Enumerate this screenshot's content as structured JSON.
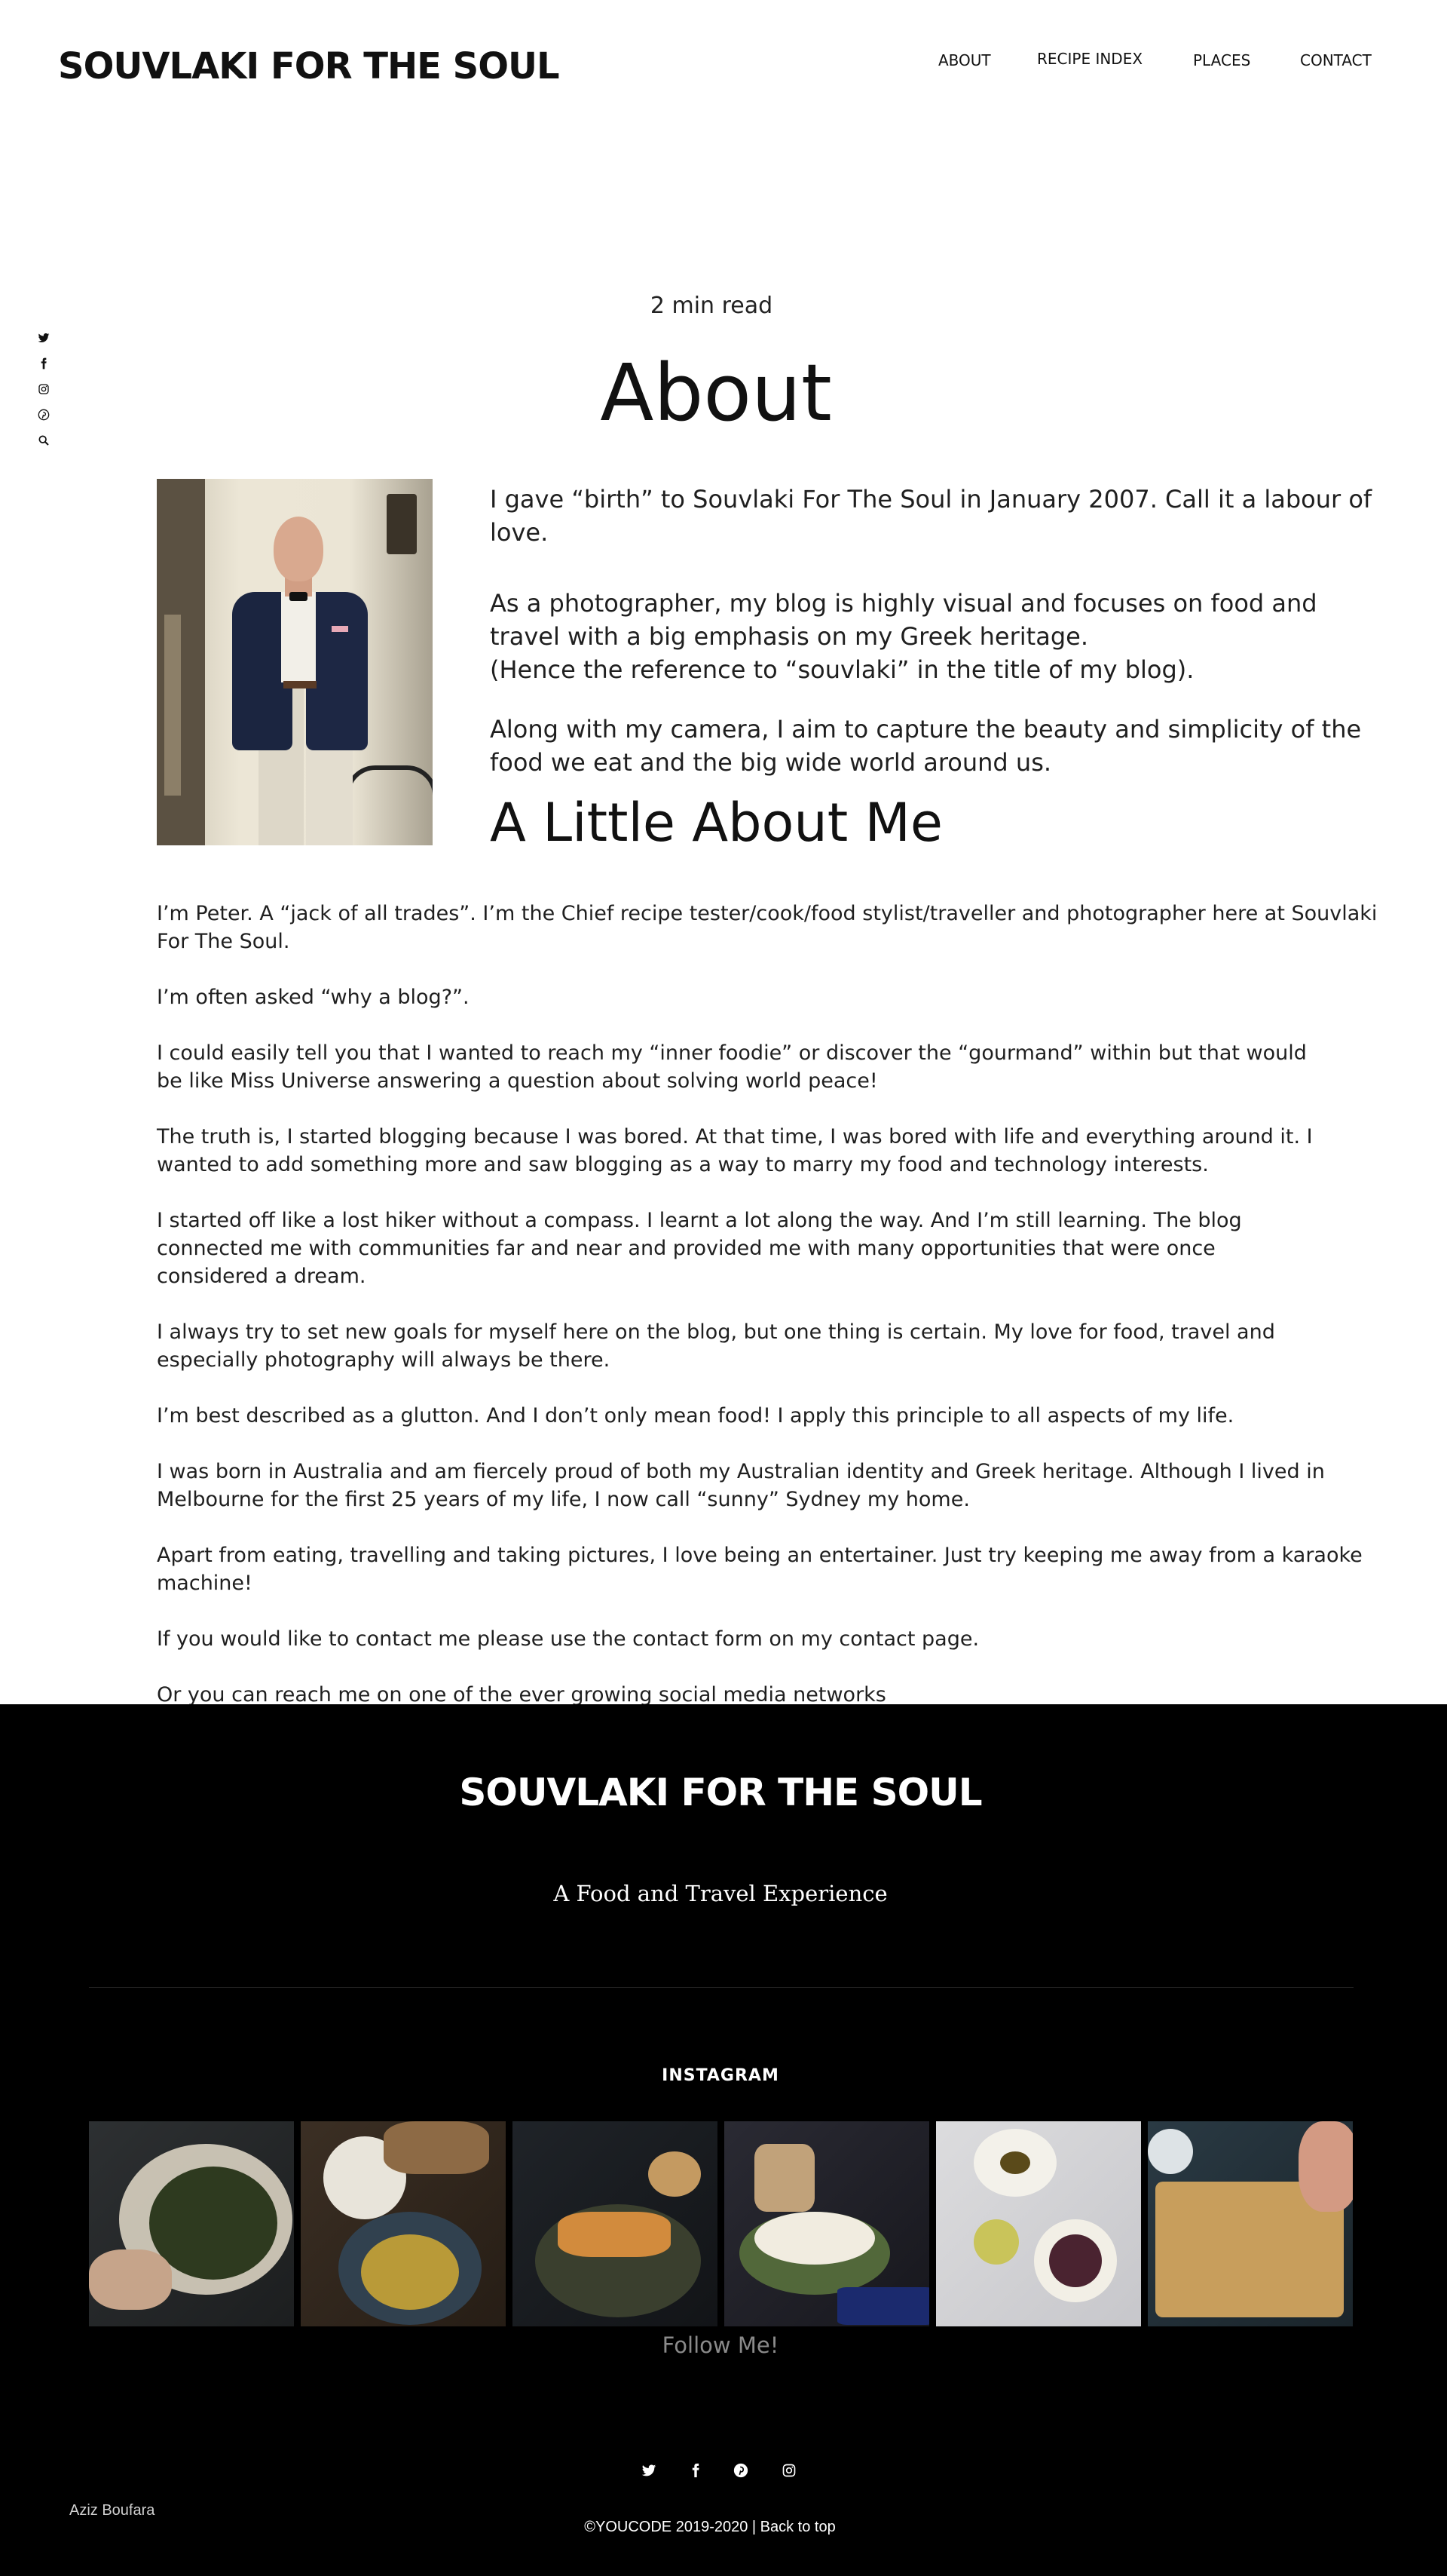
{
  "header": {
    "brand": "SOUVLAKI FOR THE SOUL",
    "nav": [
      "ABOUT",
      "RECIPE INDEX",
      "PLACES",
      "CONTACT"
    ]
  },
  "sidebar_social": {
    "icons": [
      "twitter-icon",
      "facebook-icon",
      "instagram-icon",
      "pinterest-icon",
      "search-icon"
    ]
  },
  "article": {
    "read_time": "2 min read",
    "title": "About",
    "intro": [
      "I gave “birth” to Souvlaki For The Soul in January 2007. Call it a labour of love.",
      "As a photographer, my blog is highly visual and focuses on food and travel with a big emphasis on my Greek heritage.",
      "(Hence the reference to “souvlaki” in the title of my blog).",
      "Along with my camera, I aim to capture the beauty and simplicity of the food we eat and the big wide world around us."
    ],
    "subheading": "A Little About Me",
    "paragraphs": [
      "I’m Peter. A “jack of all trades”. I’m the Chief recipe tester/cook/food stylist/traveller and photographer here at Souvlaki For The Soul.",
      "I’m often asked “why a blog?”.",
      "I could easily tell you that I wanted to reach my “inner foodie” or discover the “gourmand” within but that would be like Miss Universe answering a question about solving world peace!",
      "The truth is, I started blogging because I was bored. At that time, I was bored with life and everything around it. I wanted to add something more and saw blogging as a way to marry my food and technology interests.",
      "I started off like a lost hiker without a compass. I learnt a lot along the way. And I’m still learning. The blog connected me with communities far and near and provided me with many opportunities that were once considered a dream.",
      "I always try to set new goals for myself here on the blog, but one thing is certain. My love for food, travel and especially photography will always be there.",
      "I’m best described as a glutton. And I don’t only mean food! I apply this principle to all aspects of my life.",
      "I was born in Australia and am fiercely proud of both my Australian identity and Greek heritage. Although I lived in Melbourne for the first 25 years of my life, I now call “sunny” Sydney my home.",
      "Apart from eating, travelling and taking pictures, I love being an entertainer. Just try keeping me away from a karaoke machine!",
      "If you would like to contact me please use the contact form on my contact page.",
      "Or you can reach me on one of the ever growing social media networks"
    ]
  },
  "footer": {
    "brand": "SOUVLAKI FOR THE SOUL",
    "tagline": "A Food and Travel Experience",
    "instagram_label": "INSTAGRAM",
    "follow": "Follow Me!",
    "social_icons": [
      "twitter-icon",
      "facebook-icon",
      "pinterest-icon",
      "instagram-icon"
    ],
    "author": "Aziz Boufara",
    "copyright": "©YOUCODE 2019-2020 | ",
    "back_to_top": "Back to top"
  }
}
